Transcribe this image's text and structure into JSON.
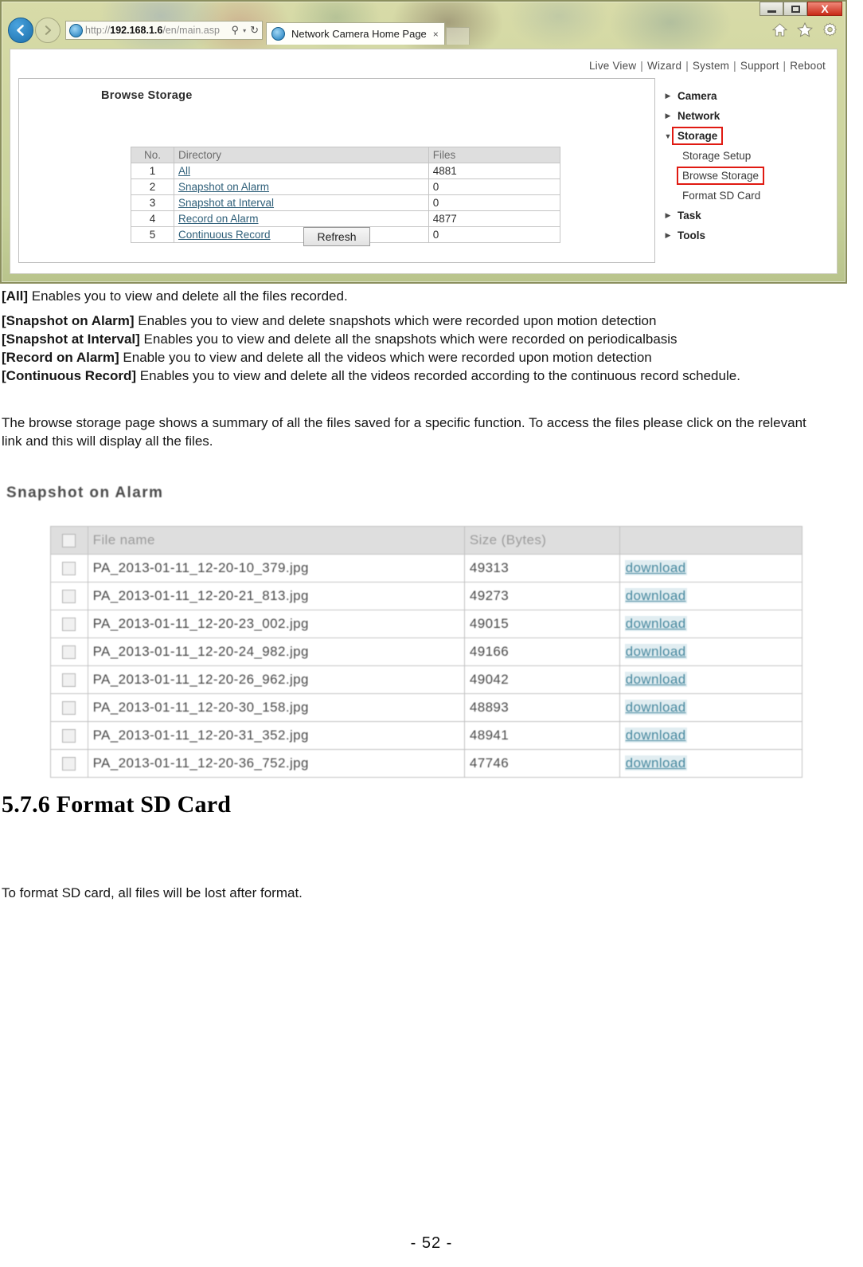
{
  "browser": {
    "window_controls": {
      "minimize": "minimize",
      "maximize": "maximize",
      "close": "X"
    },
    "back_label": "←",
    "forward_label": "→",
    "url_prefix": "http://",
    "url_host": "192.168.1.6",
    "url_path": "/en/main.asp",
    "search_icon": "⚲",
    "refresh_icon": "↻",
    "dropdown_caret": "▾",
    "tab_title": "Network Camera Home Page",
    "tab_close": "×",
    "toolbar_icons": [
      "home-icon",
      "favorites-star-icon",
      "tools-gear-icon"
    ]
  },
  "camera_page": {
    "topnav": [
      "Live View",
      "Wizard",
      "System",
      "Support",
      "Reboot"
    ],
    "topnav_separator": "|",
    "panel_title": "Browse Storage",
    "storage_table": {
      "headers": [
        "No.",
        "Directory",
        "Files"
      ],
      "rows": [
        {
          "no": "1",
          "directory": "All",
          "files": "4881"
        },
        {
          "no": "2",
          "directory": "Snapshot on Alarm",
          "files": "0"
        },
        {
          "no": "3",
          "directory": "Snapshot at Interval",
          "files": "0"
        },
        {
          "no": "4",
          "directory": "Record on Alarm",
          "files": "4877"
        },
        {
          "no": "5",
          "directory": "Continuous Record",
          "files": "0"
        }
      ]
    },
    "refresh_button": "Refresh",
    "menu": [
      {
        "label": "Camera",
        "type": "group",
        "expanded": false,
        "highlight": false
      },
      {
        "label": "Network",
        "type": "group",
        "expanded": false,
        "highlight": false
      },
      {
        "label": "Storage",
        "type": "group",
        "expanded": true,
        "highlight": true
      },
      {
        "label": "Storage Setup",
        "type": "item",
        "highlight": false
      },
      {
        "label": "Browse Storage",
        "type": "item",
        "highlight": true
      },
      {
        "label": "Format SD Card",
        "type": "item",
        "highlight": false
      },
      {
        "label": "Task",
        "type": "group",
        "expanded": false,
        "highlight": false
      },
      {
        "label": "Tools",
        "type": "group",
        "expanded": false,
        "highlight": false
      }
    ],
    "collapsed_marker": "▶",
    "expanded_marker": "▼"
  },
  "document": {
    "para_all_label": "[All]",
    "para_all_text": " Enables you to view and delete all the files recorded.",
    "para_defs": [
      {
        "label": "[Snapshot on Alarm]",
        "text": " Enables you to view and delete snapshots which were recorded upon motion detection"
      },
      {
        "label": "[Snapshot at Interval]",
        "text": " Enables you to view and delete all the snapshots which were recorded on periodicalbasis"
      },
      {
        "label": "[Record on Alarm]",
        "text": " Enable you to view and delete all the videos which were recorded upon motion detection"
      },
      {
        "label": "[Continuous Record]",
        "text": " Enables you to view and delete all the videos recorded according to the continuous record schedule."
      }
    ],
    "para_summary": "The browse storage page shows a summary of all the files saved for a specific function. To access the files please click on the relevant link and this will display all the files.",
    "section_heading": "5.7.6 Format SD Card",
    "tail_text": "To format SD card, all files will be lost after format.",
    "footer_page": "- 52 -"
  },
  "snapshot_block": {
    "title": "Snapshot on Alarm",
    "headers": [
      "",
      "File name",
      "Size  (Bytes)",
      ""
    ],
    "download_label": "download",
    "rows": [
      {
        "name": "PA_2013-01-11_12-20-10_379.jpg",
        "size": "49313"
      },
      {
        "name": "PA_2013-01-11_12-20-21_813.jpg",
        "size": "49273"
      },
      {
        "name": "PA_2013-01-11_12-20-23_002.jpg",
        "size": "49015"
      },
      {
        "name": "PA_2013-01-11_12-20-24_982.jpg",
        "size": "49166"
      },
      {
        "name": "PA_2013-01-11_12-20-26_962.jpg",
        "size": "49042"
      },
      {
        "name": "PA_2013-01-11_12-20-30_158.jpg",
        "size": "48893"
      },
      {
        "name": "PA_2013-01-11_12-20-31_352.jpg",
        "size": "48941"
      },
      {
        "name": "PA_2013-01-11_12-20-36_752.jpg",
        "size": "47746"
      }
    ]
  },
  "colors": {
    "highlight_red": "#e01a12",
    "link_blue": "#30607a",
    "download_blue": "#2e85a3",
    "close_red": "#c82a17"
  }
}
